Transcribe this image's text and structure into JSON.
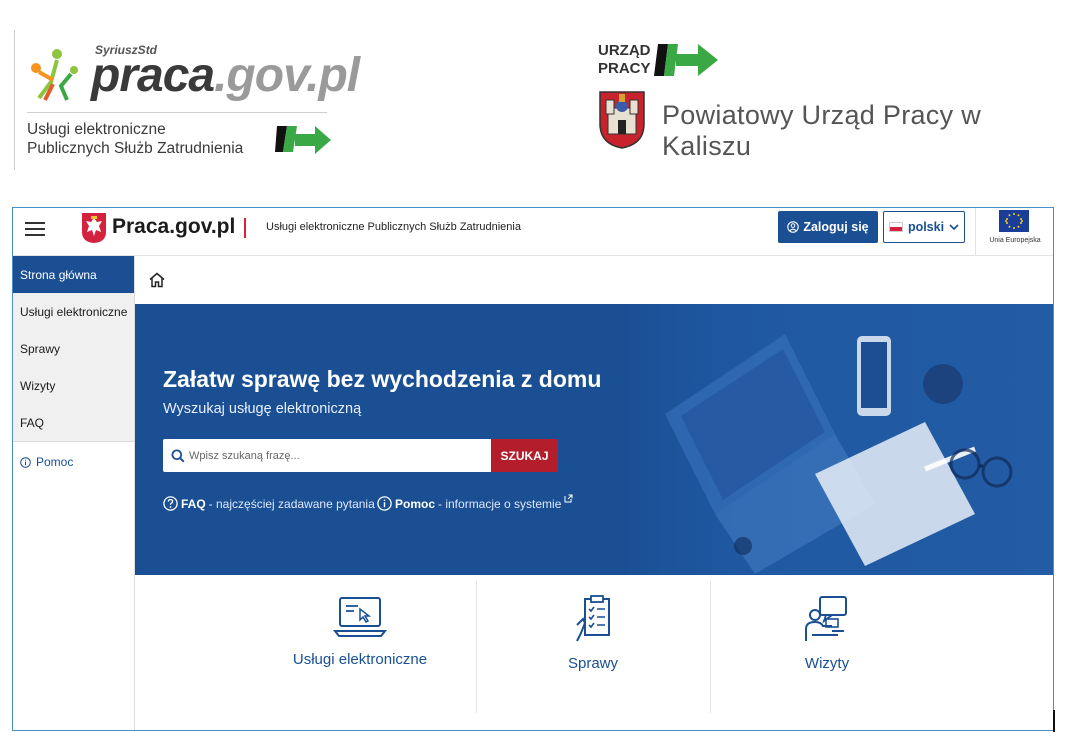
{
  "banner": {
    "syriusz_sup": "SyriuszStd",
    "praca_dark": "praca",
    "praca_gray": ".gov.pl",
    "uslugi_line1": "Usługi elektroniczne",
    "uslugi_line2": "Publicznych Służb Zatrudnienia",
    "urzad_line1": "URZĄD",
    "urzad_line2": "PRACY",
    "pup_name": "Powiatowy Urząd Pracy w Kaliszu"
  },
  "header": {
    "site_title": "Praca.gov.pl",
    "site_subtitle": "Usługi elektroniczne Publicznych Służb Zatrudnienia",
    "login_label": "Zaloguj się",
    "language_label": "polski",
    "eu_label": "Unia Europejska"
  },
  "sidebar": {
    "items": [
      {
        "label": "Strona główna",
        "active": true
      },
      {
        "label": "Usługi elektroniczne"
      },
      {
        "label": "Sprawy"
      },
      {
        "label": "Wizyty"
      },
      {
        "label": "FAQ"
      }
    ],
    "help_label": "Pomoc"
  },
  "hero": {
    "title": "Załatw sprawę bez wychodzenia z domu",
    "subtitle": "Wyszukaj usługę elektroniczną",
    "search_placeholder": "Wpisz szukaną frazę...",
    "search_button": "SZUKAJ",
    "faq_link": {
      "strong": "FAQ",
      "desc": " - najczęściej zadawane pytania"
    },
    "help_link": {
      "strong": "Pomoc",
      "desc": " - informacje o systemie"
    }
  },
  "tiles": [
    {
      "label": "Usługi elektroniczne",
      "icon": "laptop-icon"
    },
    {
      "label": "Sprawy",
      "icon": "clipboard-icon"
    },
    {
      "label": "Wizyty",
      "icon": "meeting-icon"
    }
  ],
  "colors": {
    "primary": "#1a4f94",
    "accent_red": "#b41e2c",
    "arrow_green": "#3aa845"
  }
}
